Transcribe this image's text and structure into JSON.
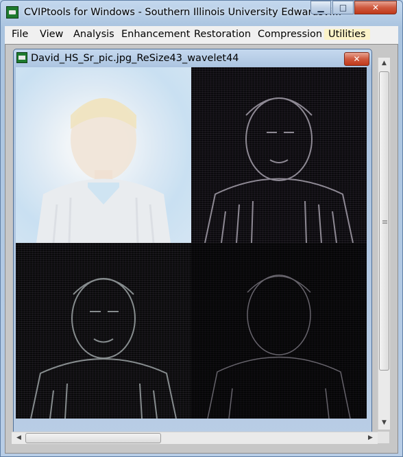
{
  "window": {
    "title": "CVIPtools for Windows - Southern Illinois University Edwardsvi...",
    "buttons": {
      "minimize": "▁",
      "maximize": "□",
      "close": "✕"
    }
  },
  "menu": {
    "items": [
      "File",
      "View",
      "Analysis",
      "Enhancement",
      "Restoration",
      "Compression",
      "Utilities"
    ]
  },
  "image_window": {
    "title": "David_HS_Sr_pic.jpg_ReSize43_wavelet44",
    "close": "✕"
  },
  "scrollbars": {
    "up": "▲",
    "down": "▼",
    "left": "◀",
    "right": "▶"
  }
}
